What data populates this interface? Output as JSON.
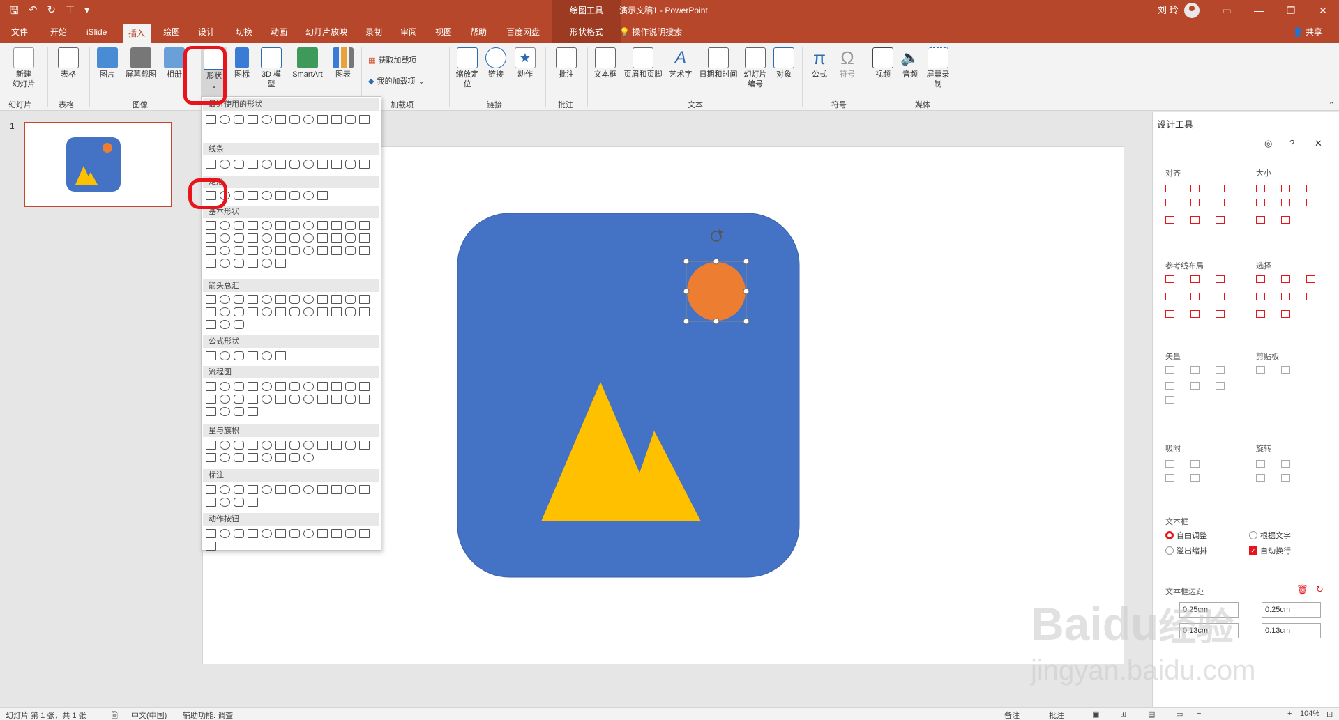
{
  "title": {
    "doc": "演示文稿1  -  PowerPoint",
    "context_group": "绘图工具",
    "user": "刘 玲"
  },
  "tabs": [
    "文件",
    "开始",
    "iSlide",
    "插入",
    "绘图",
    "设计",
    "切换",
    "动画",
    "幻灯片放映",
    "录制",
    "审阅",
    "视图",
    "帮助",
    "百度网盘",
    "形状格式"
  ],
  "tell_me": "操作说明搜索",
  "share": "共享",
  "ribbon": {
    "new_slide": "新建\n幻灯片",
    "table": "表格",
    "picture": "图片",
    "screenshot": "屏幕截图",
    "album": "相册",
    "shapes": "形状",
    "icons": "图标",
    "model3d": "3D 模型",
    "smartart": "SmartArt",
    "chart": "图表",
    "get_addins": "获取加载项",
    "my_addins": "我的加载项",
    "zoom": "缩放定位",
    "link": "链接",
    "action": "动作",
    "comment": "批注",
    "textbox": "文本框",
    "header_footer": "页眉和页脚",
    "wordart": "艺术字",
    "datetime": "日期和时间",
    "slide_number": "幻灯片编号",
    "object": "对象",
    "equation": "公式",
    "symbol": "符号",
    "video": "视频",
    "audio": "音频",
    "screen_record": "屏幕录制",
    "groups": {
      "slides": "幻灯片",
      "tables": "表格",
      "images": "图像",
      "addins": "加载项",
      "links": "链接",
      "comments": "批注",
      "text": "文本",
      "symbols": "符号",
      "media": "媒体"
    }
  },
  "gallery": {
    "sections": [
      "最近使用的形状",
      "线条",
      "矩形",
      "基本形状",
      "箭头总汇",
      "公式形状",
      "流程图",
      "星与旗帜",
      "标注",
      "动作按钮"
    ]
  },
  "thumbnail_number": "1",
  "pane": {
    "title": "设计工具",
    "sections": {
      "align": "对齐",
      "size": "大小",
      "guides": "参考线布局",
      "select": "选择",
      "vector": "矢量",
      "clipboard": "剪贴板",
      "snap": "吸附",
      "rotate": "旋转",
      "textframe": "文本框",
      "margins": "文本框边距"
    },
    "textframe_options": [
      "自由调整",
      "根据文字",
      "溢出缩排",
      "自动换行"
    ],
    "margins": [
      "0.25cm",
      "0.25cm",
      "0.13cm",
      "0.13cm"
    ]
  },
  "status": {
    "slide_info": "幻灯片 第 1 张，共 1 张",
    "language": "中文(中国)",
    "accessibility": "辅助功能: 调查",
    "notes": "备注",
    "comments": "批注",
    "zoom": "104%"
  },
  "watermark": {
    "brand": "Baidu",
    "cn": "经验",
    "url": "jingyan.baidu.com"
  },
  "colors": {
    "accent": "#b7472a",
    "slide_bg": "#4472c4",
    "sun": "#ed7d31",
    "mountain": "#ffc000",
    "highlight": "#e8141c"
  }
}
